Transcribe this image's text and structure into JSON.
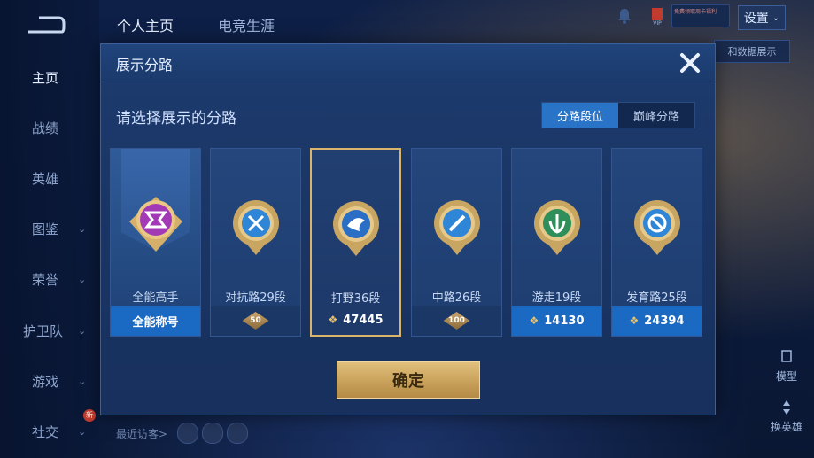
{
  "top_tabs": [
    "个人主页",
    "电竞生涯"
  ],
  "top_right": {
    "promo_text": "免费领取周卡福利",
    "settings_label": "设置",
    "chip_label": "和数据展示"
  },
  "left_nav": [
    {
      "label": "主页",
      "chevron": false
    },
    {
      "label": "战绩",
      "chevron": false
    },
    {
      "label": "英雄",
      "chevron": false
    },
    {
      "label": "图鉴",
      "chevron": true
    },
    {
      "label": "荣誉",
      "chevron": true
    },
    {
      "label": "护卫队",
      "chevron": true
    },
    {
      "label": "游戏",
      "chevron": true
    },
    {
      "label": "社交",
      "chevron": true
    }
  ],
  "social_badge": "新",
  "visitor_label": "最近访客>",
  "right_labels": {
    "mode": "模型",
    "swap": "换英雄"
  },
  "modal": {
    "title": "展示分路",
    "subtitle": "请选择展示的分路",
    "toggle": [
      "分路段位",
      "巅峰分路"
    ],
    "cards": [
      {
        "name": "全能高手",
        "footer": "全能称号",
        "footer_type": "text",
        "emblem_color": "#a23ab5"
      },
      {
        "name": "对抗路29段",
        "footer": "50",
        "footer_type": "badge",
        "emblem_color": "#2f86d6"
      },
      {
        "name": "打野36段",
        "footer": "47445",
        "footer_type": "score",
        "emblem_color": "#2a6ec6"
      },
      {
        "name": "中路26段",
        "footer": "100",
        "footer_type": "badge",
        "emblem_color": "#2f86d6"
      },
      {
        "name": "游走19段",
        "footer": "14130",
        "footer_type": "score",
        "emblem_color": "#2f8f5a"
      },
      {
        "name": "发育路25段",
        "footer": "24394",
        "footer_type": "score",
        "emblem_color": "#2f86d6"
      }
    ],
    "confirm_label": "确定"
  }
}
